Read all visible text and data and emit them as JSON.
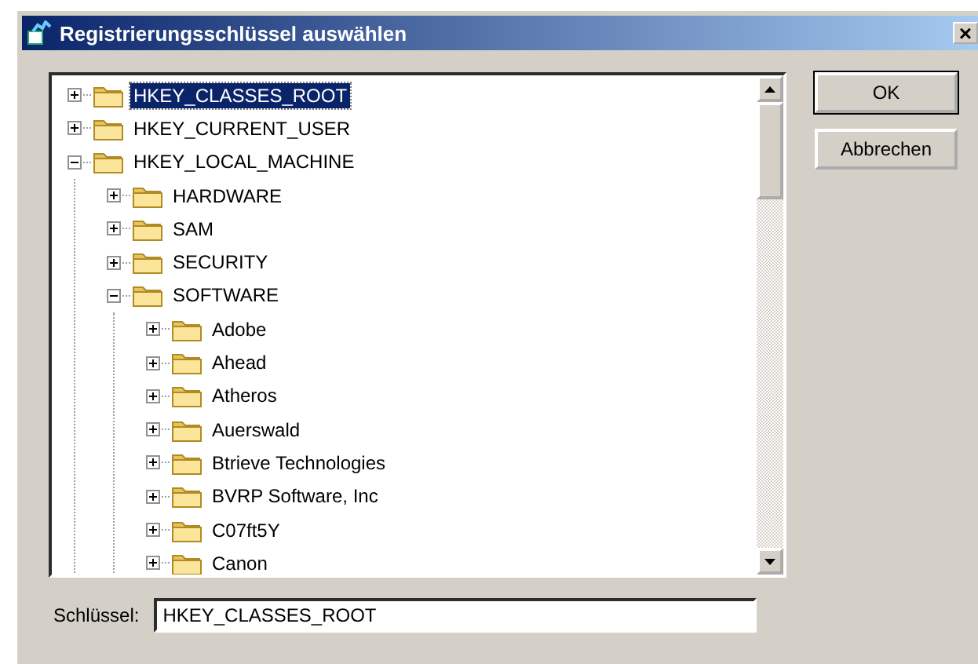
{
  "window": {
    "title": "Registrierungsschlüssel auswählen",
    "close": "×"
  },
  "tree": [
    {
      "label": "HKEY_CLASSES_ROOT",
      "expanded": false,
      "selected": true
    },
    {
      "label": "HKEY_CURRENT_USER",
      "expanded": false,
      "selected": false
    },
    {
      "label": "HKEY_LOCAL_MACHINE",
      "expanded": true,
      "selected": false,
      "children": [
        {
          "label": "HARDWARE",
          "expanded": false,
          "selected": false
        },
        {
          "label": "SAM",
          "expanded": false,
          "selected": false
        },
        {
          "label": "SECURITY",
          "expanded": false,
          "selected": false
        },
        {
          "label": "SOFTWARE",
          "expanded": true,
          "selected": false,
          "children": [
            {
              "label": "Adobe",
              "expanded": false,
              "selected": false
            },
            {
              "label": "Ahead",
              "expanded": false,
              "selected": false
            },
            {
              "label": "Atheros",
              "expanded": false,
              "selected": false
            },
            {
              "label": "Auerswald",
              "expanded": false,
              "selected": false
            },
            {
              "label": "Btrieve Technologies",
              "expanded": false,
              "selected": false
            },
            {
              "label": "BVRP Software, Inc",
              "expanded": false,
              "selected": false
            },
            {
              "label": "C07ft5Y",
              "expanded": false,
              "selected": false
            },
            {
              "label": "Canon",
              "expanded": false,
              "selected": false
            }
          ]
        }
      ]
    }
  ],
  "buttons": [
    {
      "label": "OK",
      "default": true
    },
    {
      "label": "Abbrechen",
      "default": false
    }
  ],
  "key_field": {
    "label": "Schlüssel:",
    "value": "HKEY_CLASSES_ROOT"
  }
}
